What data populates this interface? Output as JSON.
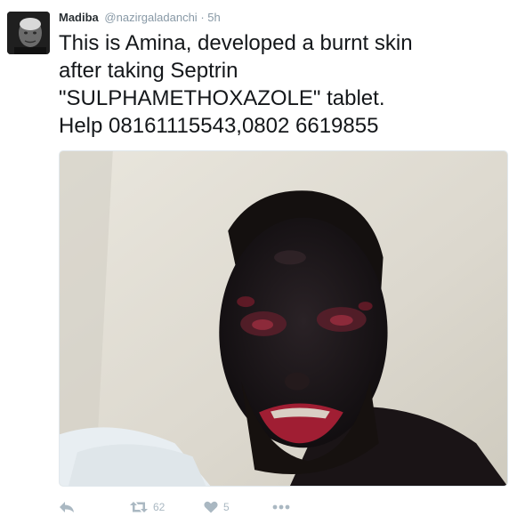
{
  "tweet": {
    "author_name": "Madiba",
    "author_handle": "@nazirgaladanchi",
    "separator": "·",
    "time": "5h",
    "text_lines": [
      "This is Amina, developed a burnt skin",
      "after taking Septrin",
      "\"SULPHAMETHOXAZOLE\" tablet.",
      "Help 08161115543,0802 6619855"
    ]
  },
  "actions": {
    "reply_icon": "reply-icon",
    "retweet_icon": "retweet-icon",
    "retweet_count": "62",
    "like_icon": "heart-icon",
    "like_count": "5",
    "more_icon": "more-dots-icon"
  },
  "colors": {
    "action_gray": "#aab8c2",
    "handle_gray": "#8899a6",
    "text_dark": "#14171a"
  }
}
